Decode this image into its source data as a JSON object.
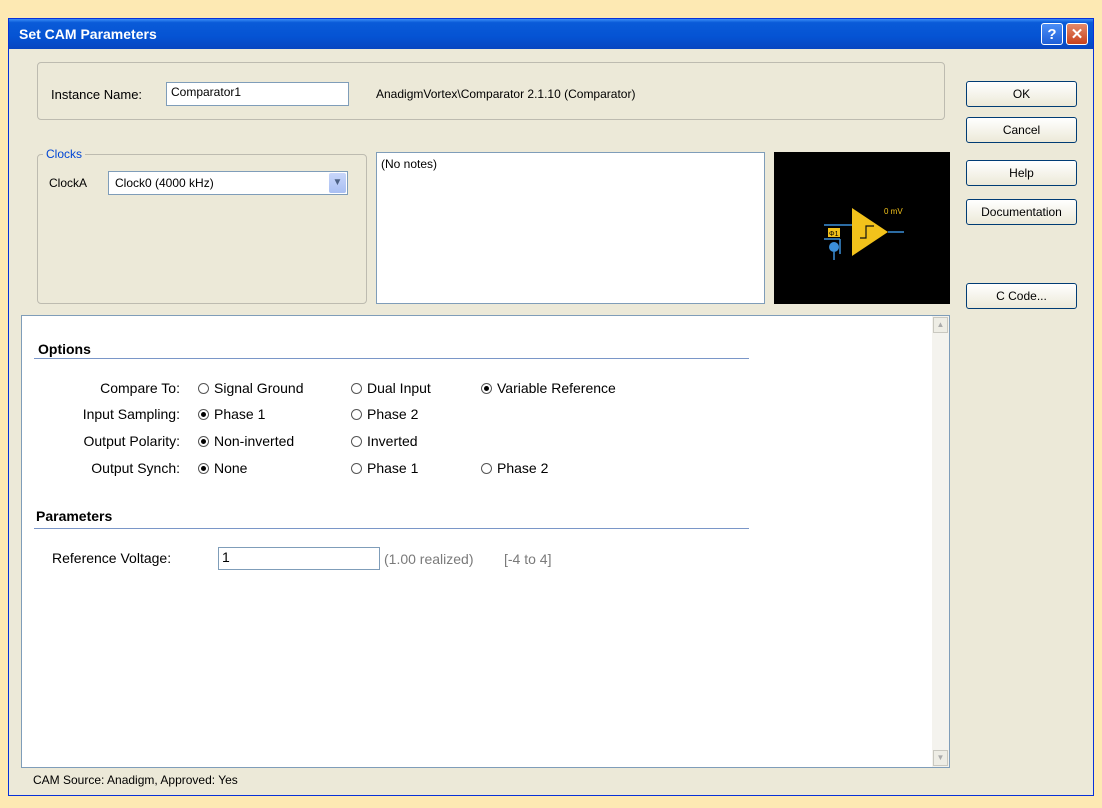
{
  "window": {
    "title": "Set CAM Parameters",
    "help_glyph": "?",
    "close_glyph": "✕"
  },
  "header": {
    "instance_label": "Instance Name:",
    "instance_value": "Comparator1",
    "cam_info": "AnadigmVortex\\Comparator 2.1.10 (Comparator)"
  },
  "clocks": {
    "group_label": "Clocks",
    "clock_label": "ClockA",
    "clock_value": "Clock0  (4000 kHz)"
  },
  "notes": {
    "text": "(No notes)"
  },
  "schematic": {
    "label_mv": "0 mV",
    "label_phase": "Φ1"
  },
  "buttons": {
    "ok": "OK",
    "cancel": "Cancel",
    "help": "Help",
    "documentation": "Documentation",
    "c_code": "C Code..."
  },
  "options": {
    "title": "Options",
    "rows": [
      {
        "label": "Compare To:",
        "choices": [
          "Signal Ground",
          "Dual Input",
          "Variable Reference"
        ],
        "selected": 2
      },
      {
        "label": "Input Sampling:",
        "choices": [
          "Phase 1",
          "Phase 2"
        ],
        "selected": 0
      },
      {
        "label": "Output Polarity:",
        "choices": [
          "Non-inverted",
          "Inverted"
        ],
        "selected": 0
      },
      {
        "label": "Output Synch:",
        "choices": [
          "None",
          "Phase 1",
          "Phase 2"
        ],
        "selected": 0
      }
    ]
  },
  "parameters": {
    "title": "Parameters",
    "ref_label": "Reference Voltage:",
    "ref_value": "1",
    "ref_realized": "(1.00 realized)",
    "ref_range": "[-4 to 4]"
  },
  "status": {
    "text": "CAM Source: Anadigm, Approved: Yes"
  },
  "colors": {
    "title_bar": "#0553d3",
    "dialog_bg": "#ece9d8",
    "section_line": "#7a96c8",
    "schematic_bg": "#000000",
    "opamp": "#f2c21b"
  }
}
